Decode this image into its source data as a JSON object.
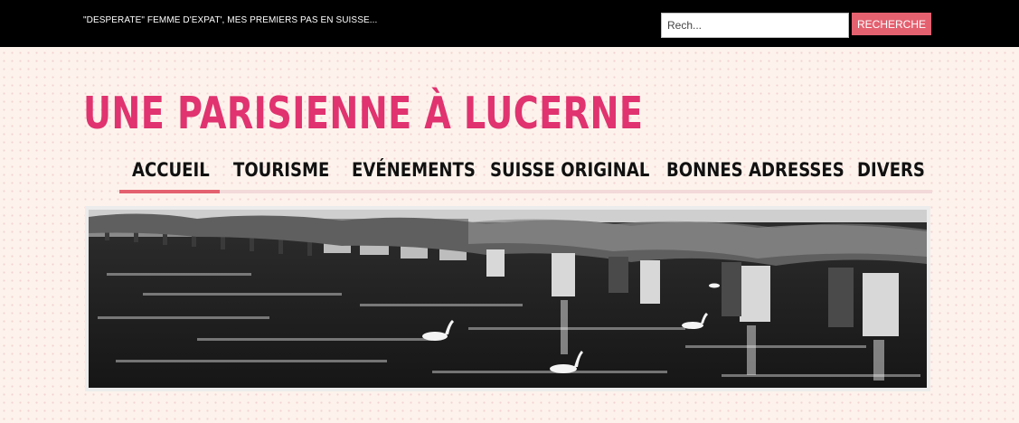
{
  "header": {
    "tagline": "\"DESPERATE\" FEMME D'EXPAT', MES PREMIERS PAS EN SUISSE...",
    "search": {
      "placeholder": "Rech...",
      "button_label": "RECHERCHE"
    }
  },
  "site": {
    "title": "UNE PARISIENNE À LUCERNE"
  },
  "nav": {
    "items": [
      {
        "label": "ACCUEIL",
        "active": true
      },
      {
        "label": "TOURISME",
        "active": false
      },
      {
        "label": "EVÉNEMENTS",
        "active": false
      },
      {
        "label": "SUISSE ORIGINAL",
        "active": false
      },
      {
        "label": "BONNES ADRESSES",
        "active": false
      },
      {
        "label": "DIVERS",
        "active": false
      }
    ]
  },
  "colors": {
    "brand_pink": "#e0336f",
    "button_pink": "#e46170",
    "topbar": "#000000",
    "page_background": "#fdf3ec",
    "nav_underline": "#f3d9d9"
  },
  "banner": {
    "style": "black-and-white photo"
  }
}
